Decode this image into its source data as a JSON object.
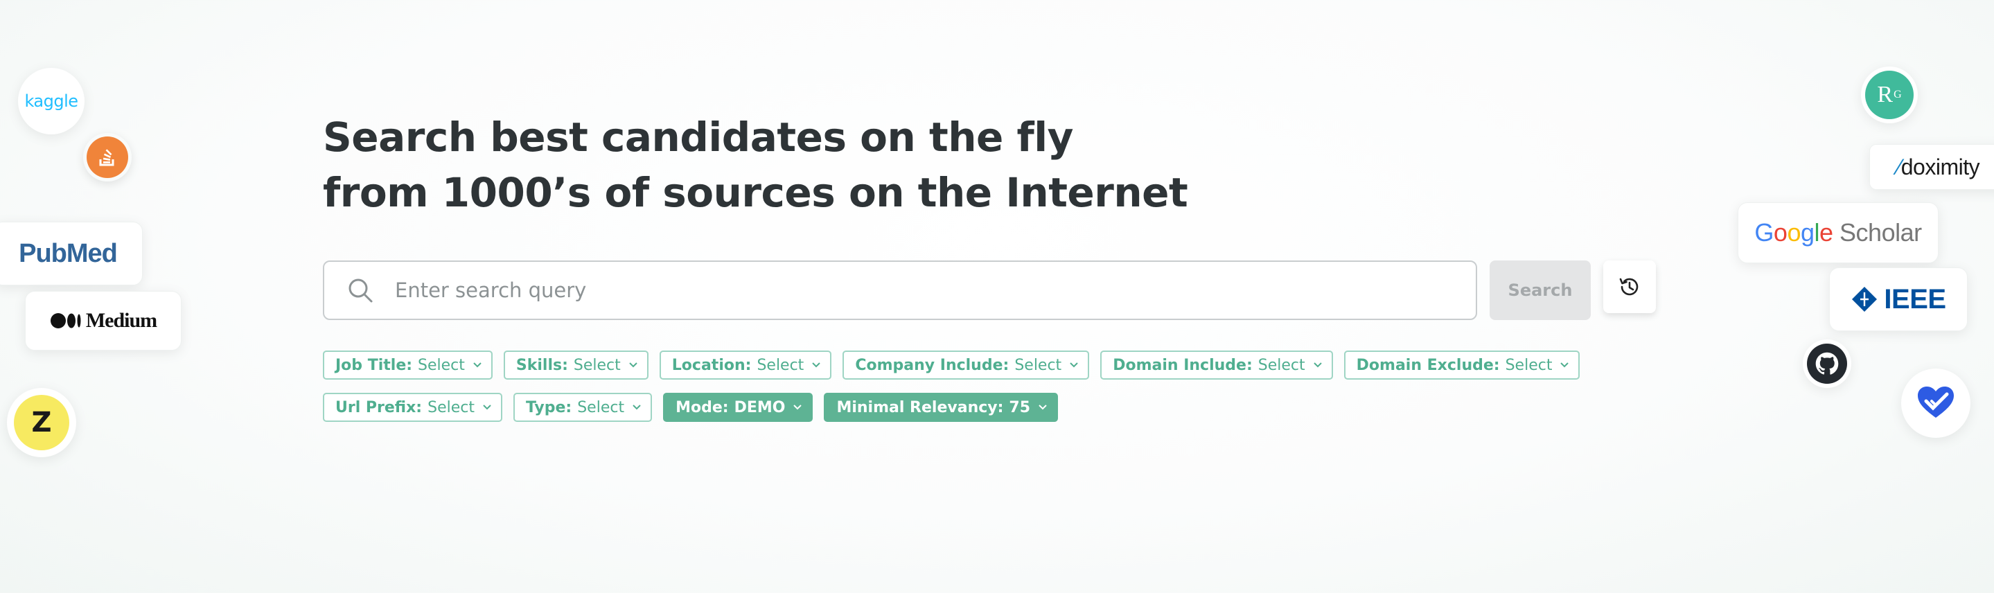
{
  "headline": {
    "line1": "Search best candidates on the fly",
    "line2": "from 1000’s of sources on the Internet"
  },
  "search": {
    "placeholder": "Enter search query",
    "value": "",
    "button_label": "Search"
  },
  "filters": {
    "row1": [
      {
        "key": "Job Title:",
        "value": "Select"
      },
      {
        "key": "Skills:",
        "value": "Select"
      },
      {
        "key": "Location:",
        "value": "Select"
      },
      {
        "key": "Company Include:",
        "value": "Select"
      },
      {
        "key": "Domain Include:",
        "value": "Select"
      },
      {
        "key": "Domain Exclude:",
        "value": "Select"
      }
    ],
    "row2": [
      {
        "key": "Url Prefix:",
        "value": "Select"
      },
      {
        "key": "Type:",
        "value": "Select"
      },
      {
        "key": "Mode:",
        "value": "DEMO"
      },
      {
        "key": "Minimal Relevancy:",
        "value": "75"
      }
    ]
  },
  "sources": {
    "kaggle": "kaggle",
    "pubmed_pub": "Pub",
    "pubmed_med": "Med",
    "medium": "Medium",
    "zenodo": "Z",
    "researchgate_r": "R",
    "researchgate_g": "G",
    "doximity": "doximity",
    "google": "Google",
    "scholar": "Scholar",
    "ieee": "IEEE"
  },
  "colors": {
    "accent": "#5eb394",
    "chip_border": "#9fd5c4",
    "chip_text": "#4fae8f",
    "search_button_bg": "#e4e5e6"
  }
}
